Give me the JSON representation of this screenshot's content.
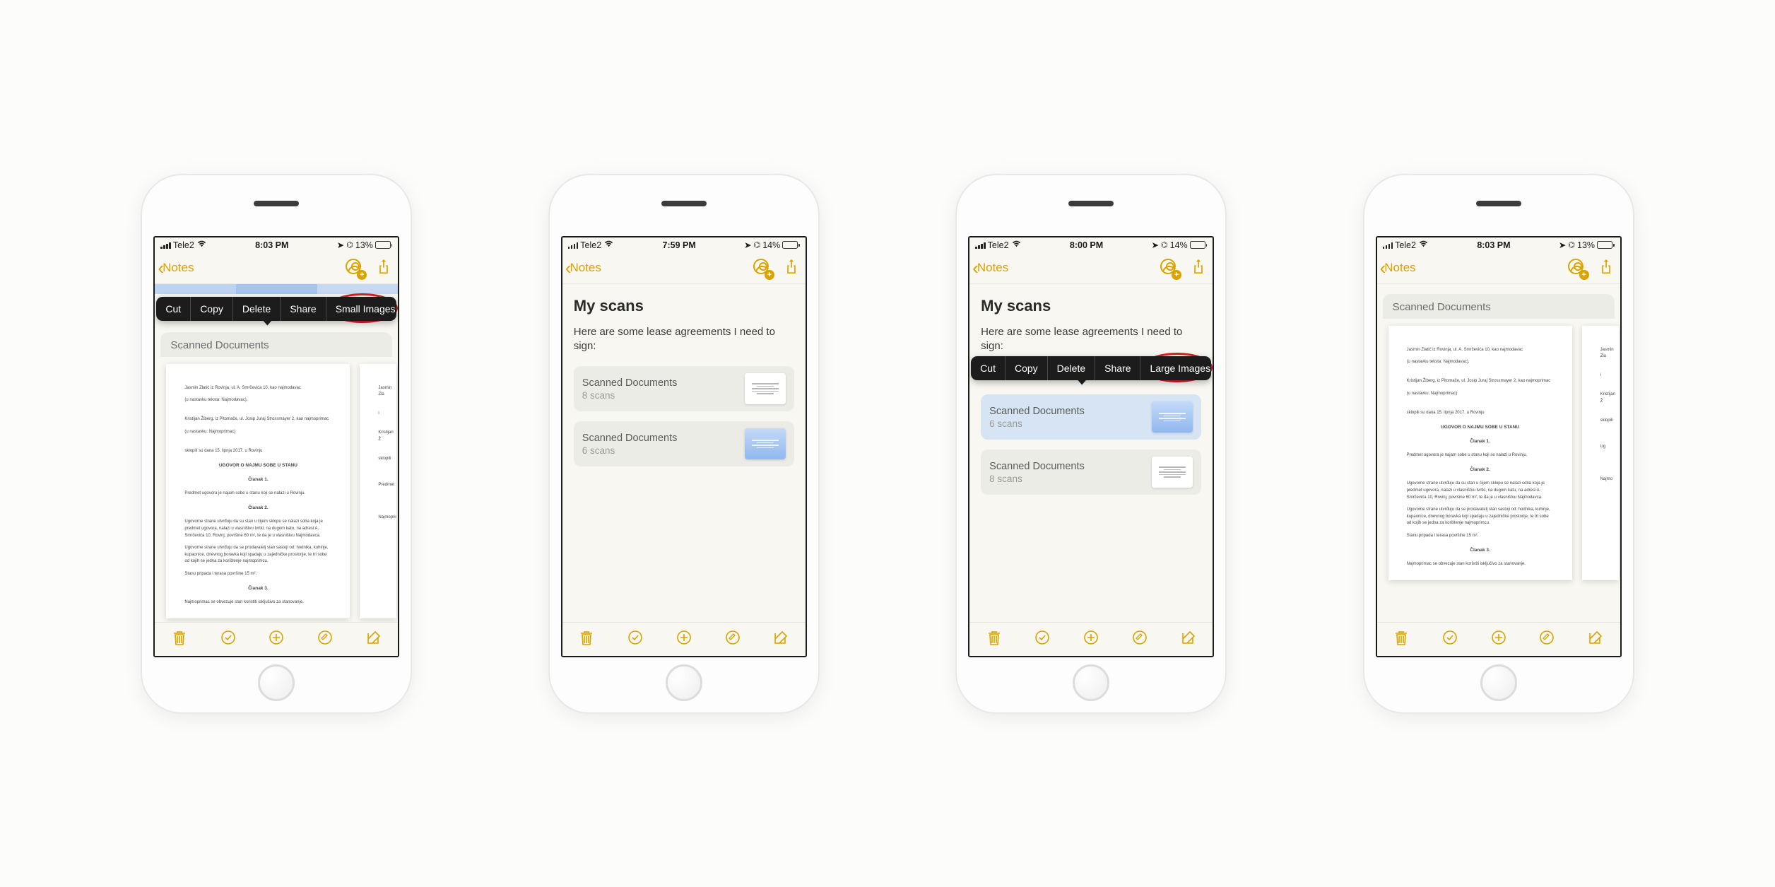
{
  "phones": [
    {
      "status": {
        "carrier": "Tele2",
        "time": "8:03 PM",
        "battery": "13%",
        "battery_fill": 13,
        "battery_color": "#e64c3c"
      },
      "nav": {
        "back": "Notes"
      },
      "view": "large_selected_small_option",
      "section": "Scanned Documents",
      "context": [
        "Cut",
        "Copy",
        "Delete",
        "Share",
        "Small Images"
      ],
      "circled": "Small Images"
    },
    {
      "status": {
        "carrier": "Tele2",
        "time": "7:59 PM",
        "battery": "14%",
        "battery_fill": 14,
        "battery_color": "#e64c3c"
      },
      "nav": {
        "back": "Notes"
      },
      "title": "My scans",
      "body": "Here are some lease agreements I need to sign:",
      "attachments": [
        {
          "title": "Scanned Documents",
          "sub": "8 scans",
          "tint": "white"
        },
        {
          "title": "Scanned Documents",
          "sub": "6 scans",
          "tint": "blue"
        }
      ]
    },
    {
      "status": {
        "carrier": "Tele2",
        "time": "8:00 PM",
        "battery": "14%",
        "battery_fill": 14,
        "battery_color": "#e64c3c"
      },
      "nav": {
        "back": "Notes"
      },
      "title": "My scans",
      "body": "Here are some lease agreements I need to sign:",
      "context": [
        "Cut",
        "Copy",
        "Delete",
        "Share",
        "Large Images"
      ],
      "circled": "Large Images",
      "attachments": [
        {
          "title": "Scanned Documents",
          "sub": "6 scans",
          "tint": "blue",
          "selected": true
        },
        {
          "title": "Scanned Documents",
          "sub": "8 scans",
          "tint": "white"
        }
      ]
    },
    {
      "status": {
        "carrier": "Tele2",
        "time": "8:03 PM",
        "battery": "13%",
        "battery_fill": 13,
        "battery_color": "#e64c3c"
      },
      "nav": {
        "back": "Notes"
      },
      "view": "large_plain",
      "section": "Scanned Documents"
    }
  ],
  "doc_text": {
    "line1": "Jasmin Zlatić iz Rovinja, ul. A. Smrčevića 10, kao najmodavac",
    "line2": "(u nastavku teksta: Najmodavac),",
    "line3": "Kristijan Žiberg, iz Pitomače, ul. Josip Juraj Strossmayer 2, kao najmoprimac",
    "line4": "(u nastavku: Najmoprimac)",
    "line5": "sklopili su dana 15. lipnja 2017. u Rovinju",
    "heading": "UGOVOR O NAJMU SOBE U STANU",
    "c1": "Članak 1.",
    "c1t": "Predmet ugovora je najam sobe u stanu koji se nalazi u Rovinju.",
    "c2": "Članak 2.",
    "c2t": "Ugovorne strane utvrđuju da su stan u čijem sklopu se nalazi soba koja je predmet ugovora, nalazi u vlasništvu tvrtki, na dugom katu, na adresi A. Smrčevića 10, Rovinj, površine 60 m², te da je u vlasništvu Najmodavca.",
    "c2t2": "Ugovorne strane utvrđuju da se prodavatelj stan sastoji od: hodnika, kuhinje, kupaonice, dnevnog boravka koji spadaju u zajedničke prostorije, te tri sobe od kojih se jedna za korištenje najmoprimcu.",
    "c2t3": "Stanu pripada i terasa površine 15 m².",
    "c3": "Članak 3.",
    "c3t": "Najmoprimac se obvezuje stan koristiti isključivo za stanovanje."
  }
}
